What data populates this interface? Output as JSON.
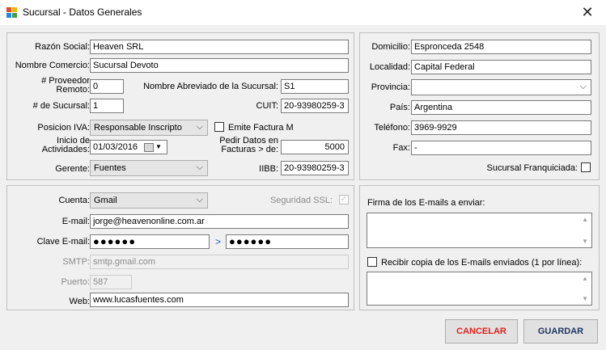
{
  "window": {
    "title": "Sucursal - Datos Generales",
    "close_glyph": "✕"
  },
  "general": {
    "razon_social": {
      "label": "Razón Social:",
      "value": "Heaven SRL"
    },
    "nombre_comercio": {
      "label": "Nombre Comercio:",
      "value": "Sucursal Devoto"
    },
    "proveedor_remoto": {
      "label": "# Proveedor Remoto:",
      "value": "0"
    },
    "nombre_abreviado": {
      "label": "Nombre Abreviado de la Sucursal:",
      "value": "S1"
    },
    "num_sucursal": {
      "label": "# de Sucursal:",
      "value": "1"
    },
    "cuit": {
      "label": "CUIT:",
      "value": "20-93980259-3"
    },
    "posicion_iva": {
      "label": "Posicion IVA:",
      "value": "Responsable Inscripto"
    },
    "emite_factura_m": {
      "label": "Emite Factura M",
      "checked": false
    },
    "inicio_actividades": {
      "label": "Inicio de Actividades:",
      "value": "01/03/2016"
    },
    "pedir_datos": {
      "label": "Pedir Datos en Facturas > de:",
      "value": "5000"
    },
    "gerente": {
      "label": "Gerente:",
      "value": "Fuentes"
    },
    "iibb": {
      "label": "IIBB:",
      "value": "20-93980259-3"
    }
  },
  "address": {
    "domicilio": {
      "label": "Domicilio:",
      "value": "Espronceda 2548"
    },
    "localidad": {
      "label": "Localidad:",
      "value": "Capital Federal"
    },
    "provincia": {
      "label": "Provincia:",
      "value": ""
    },
    "pais": {
      "label": "País:",
      "value": "Argentina"
    },
    "telefono": {
      "label": "Teléfono:",
      "value": "3969-9929"
    },
    "fax": {
      "label": "Fax:",
      "value": "-"
    },
    "franquiciada": {
      "label": "Sucursal Franquiciada:",
      "checked": false
    }
  },
  "email": {
    "cuenta": {
      "label": "Cuenta:",
      "value": "Gmail"
    },
    "seguridad_ssl": {
      "label": "Seguridad SSL:",
      "checked": true
    },
    "email": {
      "label": "E-mail:",
      "value": "jorge@heavenonline.com.ar"
    },
    "clave": {
      "label": "Clave E-mail:",
      "value": "●●●●●●",
      "confirm": "●●●●●●",
      "arrow": ">"
    },
    "smtp": {
      "label": "SMTP:",
      "value": "smtp.gmail.com"
    },
    "puerto": {
      "label": "Puerto:",
      "value": "587"
    },
    "web": {
      "label": "Web:",
      "value": "www.lucasfuentes.com"
    }
  },
  "signature": {
    "firma_label": "Firma de los E-mails a enviar:",
    "recibir_copia": {
      "label": "Recibir copia de los E-mails enviados (1 por línea):",
      "checked": false
    }
  },
  "buttons": {
    "cancel": "CANCELAR",
    "save": "GUARDAR"
  },
  "colors": {
    "cancel_text": "#e0201b",
    "save_text": "#1f3864",
    "link_arrow": "#1e5fd8"
  }
}
